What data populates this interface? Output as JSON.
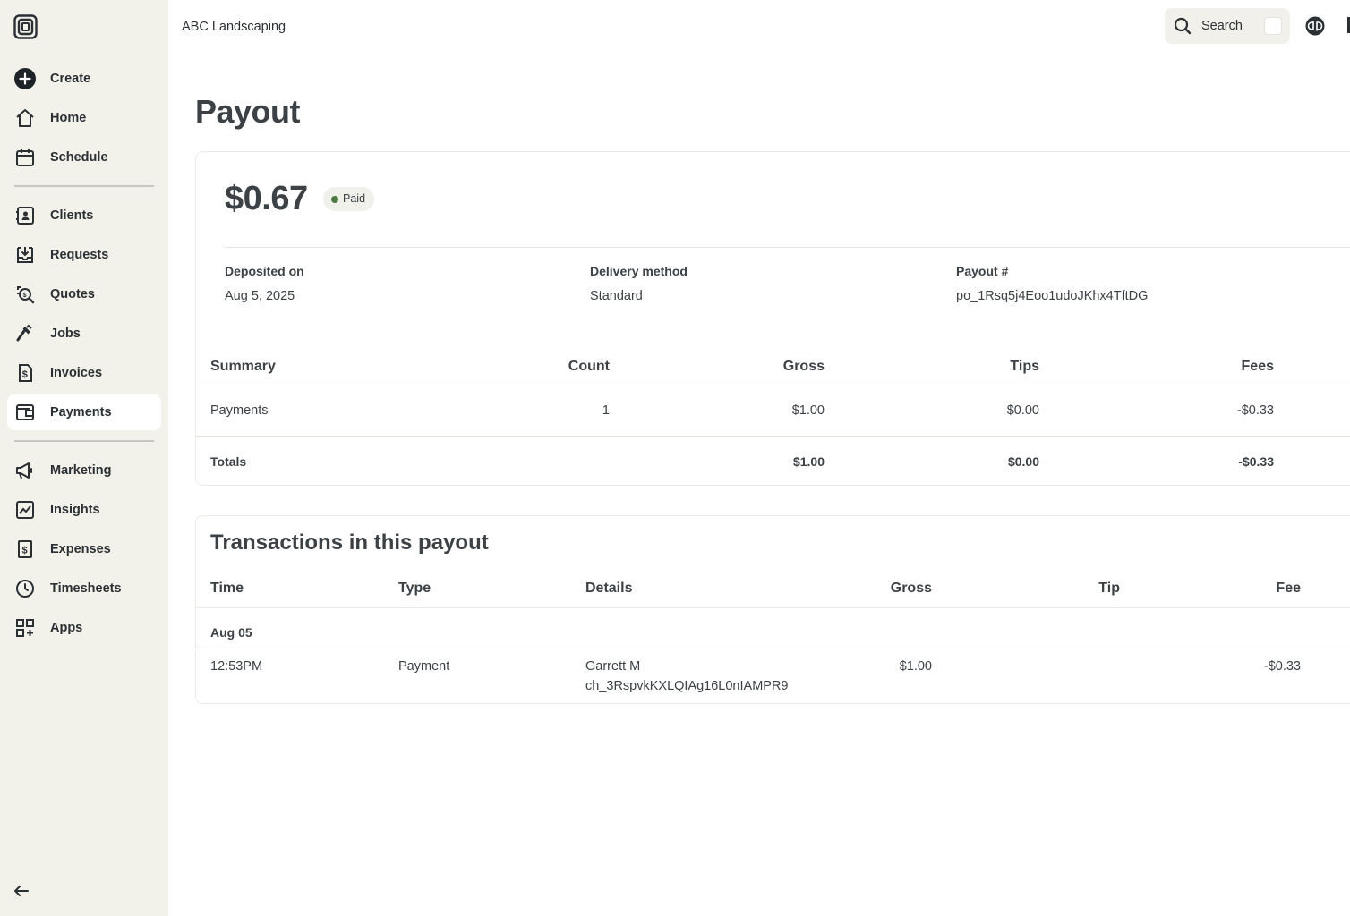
{
  "sidebar": {
    "create": "Create",
    "home": "Home",
    "schedule": "Schedule",
    "clients": "Clients",
    "requests": "Requests",
    "quotes": "Quotes",
    "jobs": "Jobs",
    "invoices": "Invoices",
    "payments": "Payments",
    "marketing": "Marketing",
    "insights": "Insights",
    "expenses": "Expenses",
    "timesheets": "Timesheets",
    "apps": "Apps",
    "active": "Payments"
  },
  "header": {
    "company": "ABC Landscaping",
    "search_label": "Search"
  },
  "page": {
    "title": "Payout",
    "amount": "$0.67",
    "status": "Paid"
  },
  "meta": {
    "deposited_label": "Deposited on",
    "deposited_value": "Aug 5, 2025",
    "delivery_label": "Delivery method",
    "delivery_value": "Standard",
    "payout_label": "Payout #",
    "payout_value": "po_1Rsq5j4Eoo1udoJKhx4TftDG"
  },
  "summary": {
    "headers": {
      "summary": "Summary",
      "count": "Count",
      "gross": "Gross",
      "tips": "Tips",
      "fees": "Fees"
    },
    "row": {
      "label": "Payments",
      "count": "1",
      "gross": "$1.00",
      "tips": "$0.00",
      "fees": "-$0.33"
    },
    "totals": {
      "label": "Totals",
      "gross": "$1.00",
      "tips": "$0.00",
      "fees": "-$0.33"
    }
  },
  "transactions": {
    "title": "Transactions in this payout",
    "headers": {
      "time": "Time",
      "type": "Type",
      "details": "Details",
      "gross": "Gross",
      "tip": "Tip",
      "fee": "Fee"
    },
    "group": "Aug 05",
    "row": {
      "time": "12:53PM",
      "type": "Payment",
      "client": "Garrett M",
      "charge_id": "ch_3RspvkKXLQIAg16L0nIAMPR9",
      "gross": "$1.00",
      "tip": "",
      "fee": "-$0.33"
    }
  },
  "colors": {
    "sidebar_bg": "#f2f1ea",
    "text": "#32373c",
    "paid_dot": "#4f7a43"
  }
}
